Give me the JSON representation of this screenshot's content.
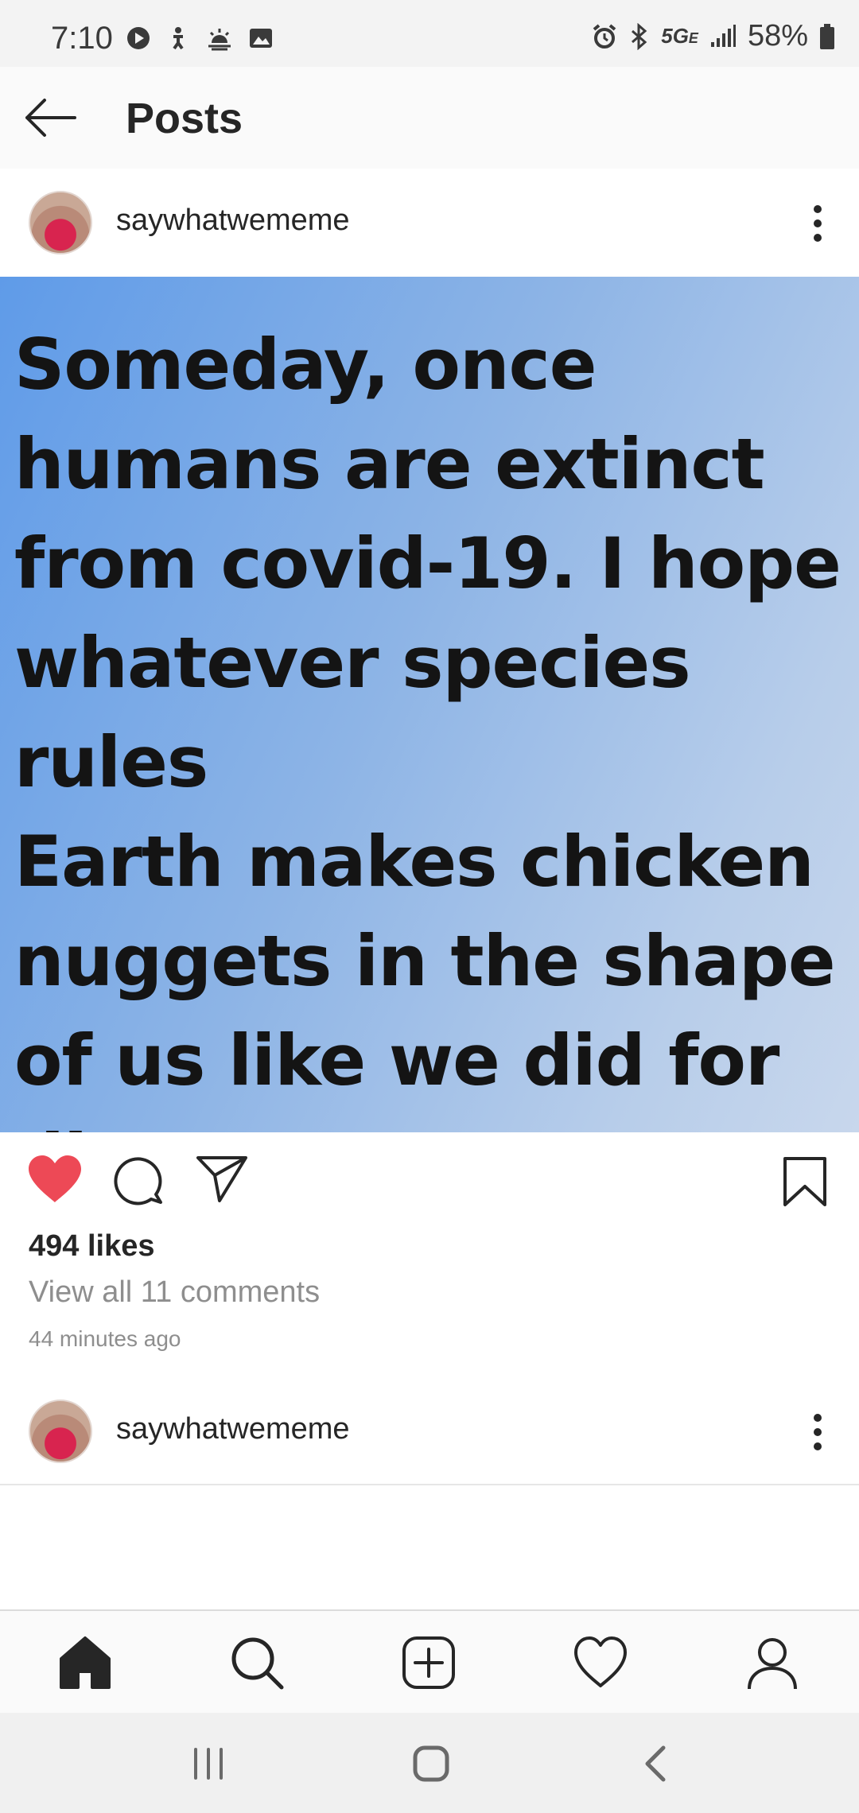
{
  "status_bar": {
    "time": "7:10",
    "network": "5G",
    "network_sub": "E",
    "battery": "58%"
  },
  "header": {
    "title": "Posts"
  },
  "post": {
    "username": "saywhatwememe",
    "image_text_lines": [
      "Someday, once",
      "humans are extinct",
      "from covid-19. I hope",
      "whatever species rules",
      "Earth makes chicken",
      "nuggets in the shape",
      "of us like we did for",
      "dinosaurs."
    ],
    "likes": "494 likes",
    "view_comments": "View all 11 comments",
    "time_ago": "44 minutes ago",
    "liked": true
  },
  "next_post": {
    "username": "saywhatwememe"
  },
  "colors": {
    "like_red": "#ed4956",
    "text": "#262626",
    "muted": "#8e8e8e"
  },
  "icons": {
    "status_left": [
      "play-icon",
      "accessibility-icon",
      "weather-icon",
      "gallery-icon"
    ],
    "status_right": [
      "alarm-icon",
      "bluetooth-icon",
      "signal-icon",
      "battery-icon"
    ],
    "post_actions": [
      "heart-icon",
      "comment-icon",
      "share-icon",
      "bookmark-icon"
    ],
    "bottom_nav": [
      "home-icon",
      "search-icon",
      "new-post-icon",
      "activity-icon",
      "profile-icon"
    ],
    "system_nav": [
      "recents-icon",
      "home-button-icon",
      "back-icon"
    ]
  }
}
